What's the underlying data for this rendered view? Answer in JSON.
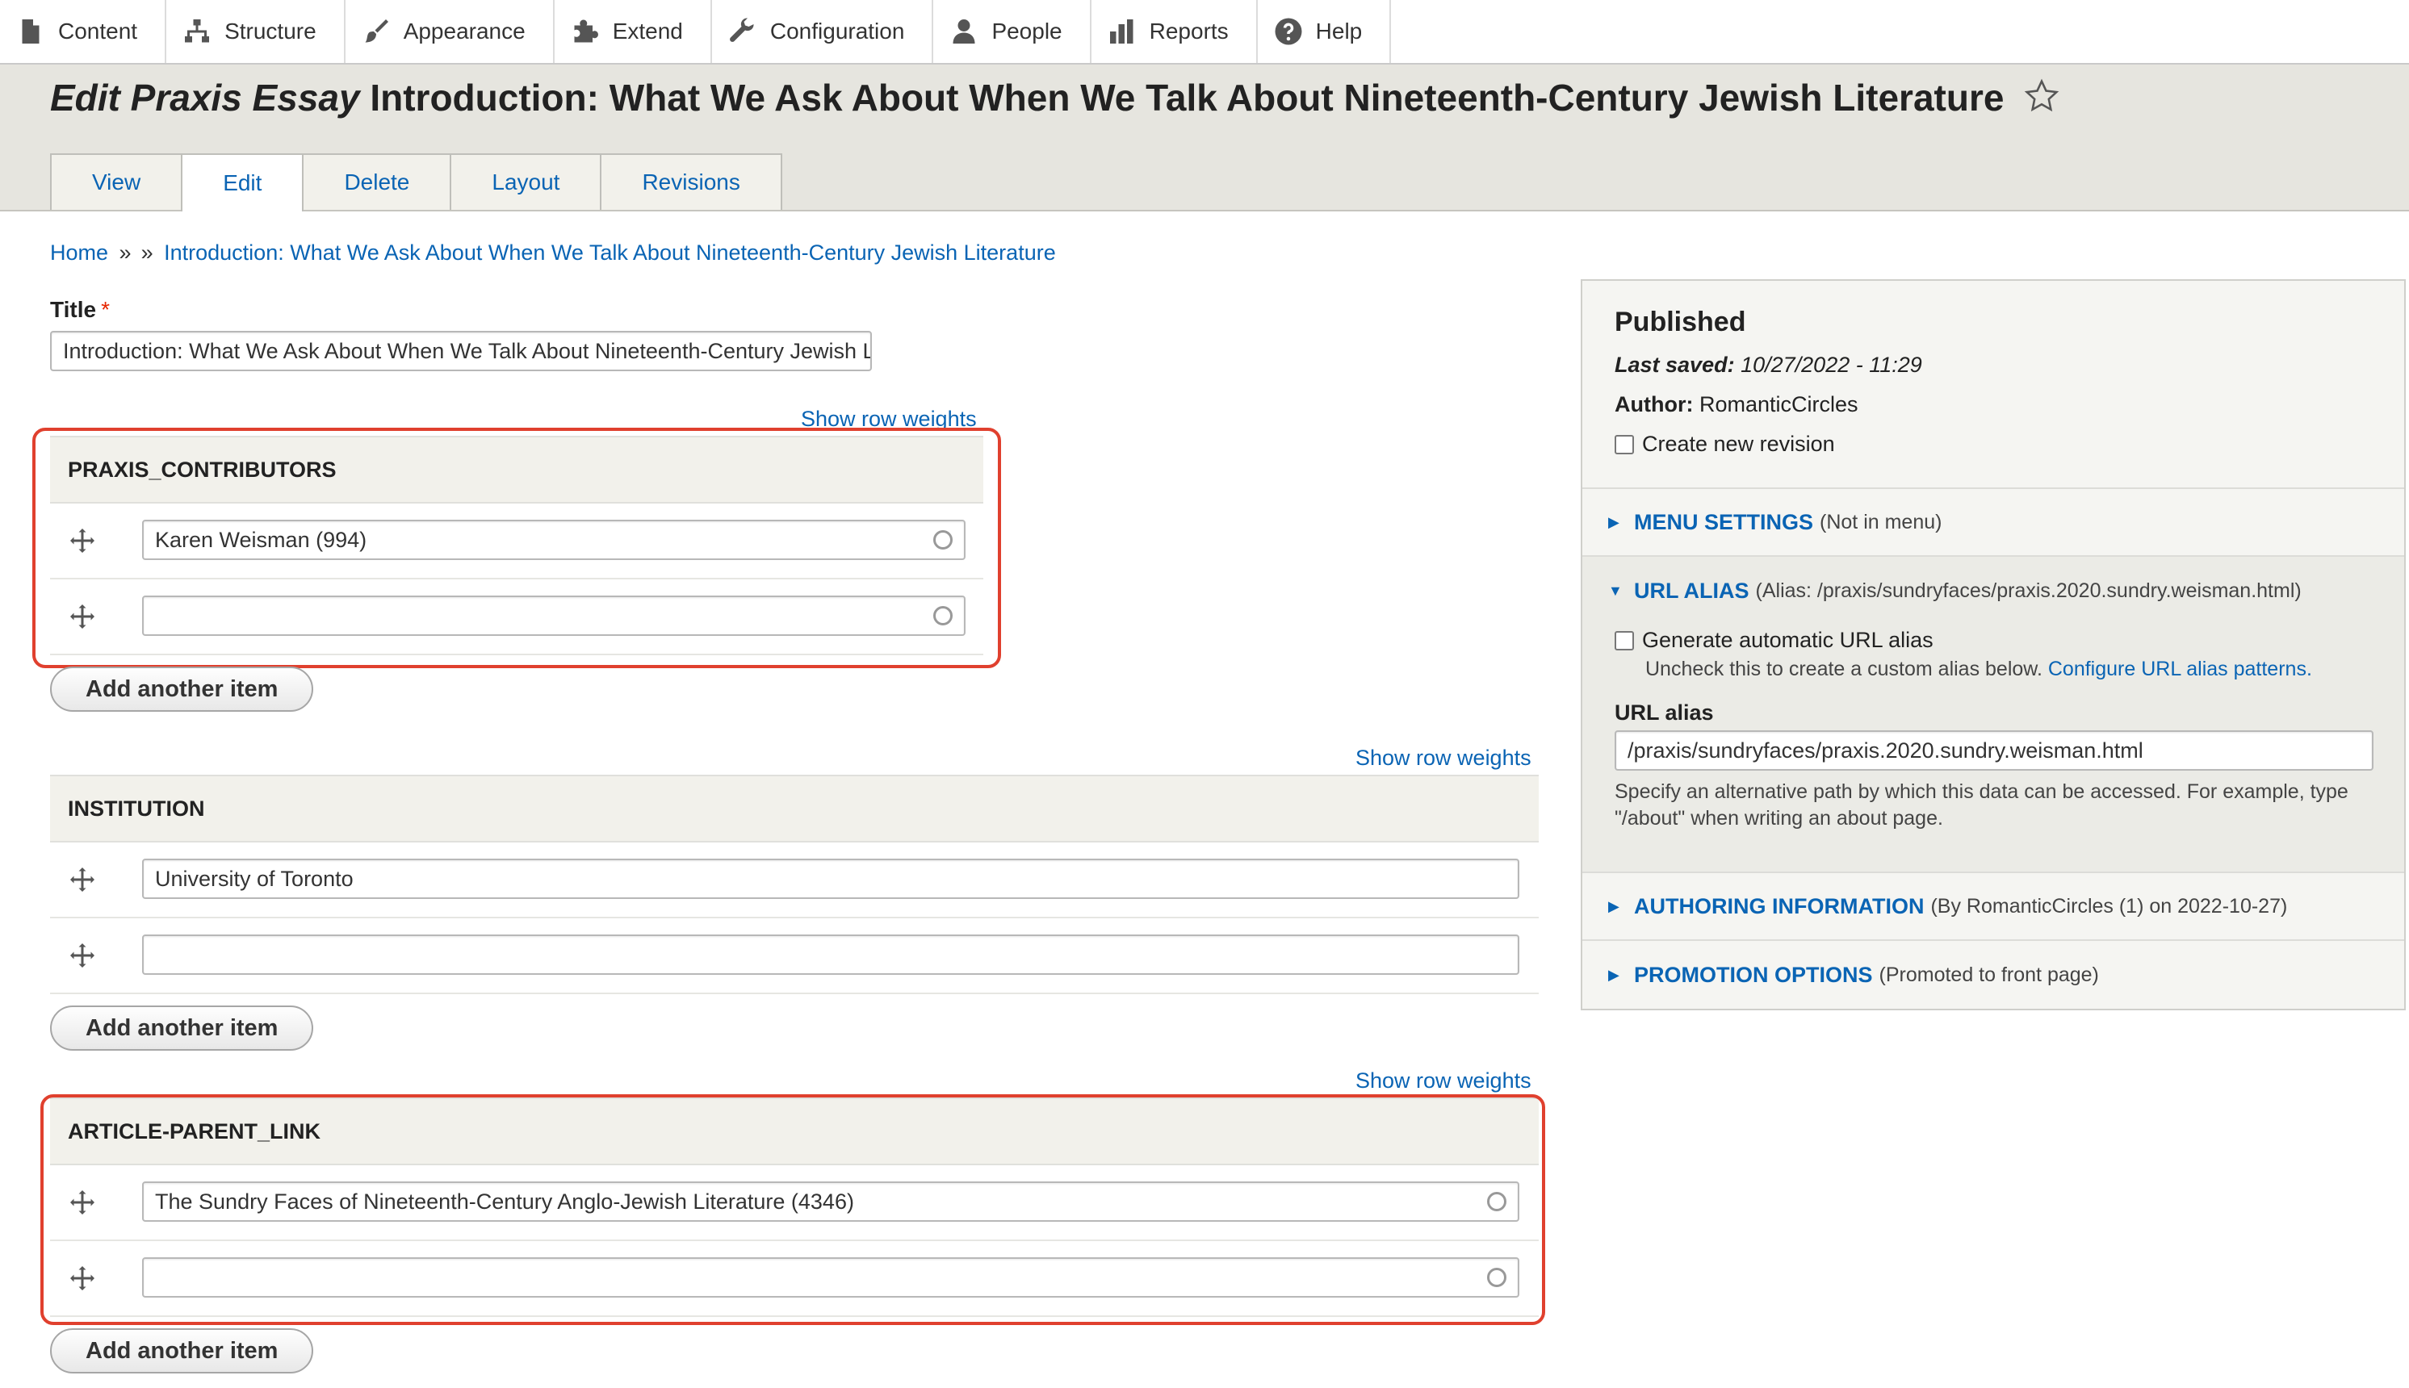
{
  "toolbar": {
    "items": [
      {
        "label": "Content",
        "icon": "page-icon"
      },
      {
        "label": "Structure",
        "icon": "sitemap-icon"
      },
      {
        "label": "Appearance",
        "icon": "paintbrush-icon"
      },
      {
        "label": "Extend",
        "icon": "puzzle-icon"
      },
      {
        "label": "Configuration",
        "icon": "wrench-icon"
      },
      {
        "label": "People",
        "icon": "person-icon"
      },
      {
        "label": "Reports",
        "icon": "bar-chart-icon"
      },
      {
        "label": "Help",
        "icon": "question-icon"
      }
    ]
  },
  "header": {
    "title_prefix": "Edit Praxis Essay",
    "title": "Introduction: What We Ask About When We Talk About Nineteenth-Century Jewish Literature",
    "tabs": [
      "View",
      "Edit",
      "Delete",
      "Layout",
      "Revisions"
    ],
    "active_tab": "Edit"
  },
  "breadcrumb": {
    "home": "Home",
    "sep": "»",
    "current": "Introduction: What We Ask About When We Talk About Nineteenth-Century Jewish Literature"
  },
  "form": {
    "title_label": "Title",
    "required_mark": "*",
    "title_value": "Introduction: What We Ask About When We Talk About Nineteenth-Century Jewish Literature",
    "show_row_weights": "Show row weights",
    "add_another": "Add another item",
    "contributors": {
      "heading": "PRAXIS_CONTRIBUTORS",
      "values": [
        "Karen Weisman (994)",
        ""
      ]
    },
    "institution": {
      "heading": "INSTITUTION",
      "values": [
        "University of Toronto",
        ""
      ]
    },
    "parent_link": {
      "heading": "ARTICLE-PARENT_LINK",
      "values": [
        "The Sundry Faces of Nineteenth-Century Anglo-Jewish Literature (4346)",
        ""
      ]
    }
  },
  "sidebar": {
    "status": "Published",
    "last_saved_label": "Last saved:",
    "last_saved_value": "10/27/2022 - 11:29",
    "author_label": "Author:",
    "author_value": "RomanticCircles",
    "new_revision_label": "Create new revision",
    "menu": {
      "title": "MENU SETTINGS",
      "summary": "(Not in menu)"
    },
    "url_alias": {
      "title": "URL ALIAS",
      "summary": "(Alias: /praxis/sundryfaces/praxis.2020.sundry.weisman.html)",
      "generate_label": "Generate automatic URL alias",
      "generate_desc": "Uncheck this to create a custom alias below.",
      "configure_link": "Configure URL alias patterns.",
      "alias_label": "URL alias",
      "alias_value": "/praxis/sundryfaces/praxis.2020.sundry.weisman.html",
      "alias_desc": "Specify an alternative path by which this data can be accessed. For example, type \"/about\" when writing an about page."
    },
    "authoring": {
      "title": "AUTHORING INFORMATION",
      "summary": "(By RomanticCircles (1) on 2022-10-27)"
    },
    "promotion": {
      "title": "PROMOTION OPTIONS",
      "summary": "(Promoted to front page)"
    }
  },
  "colors": {
    "link": "#0a64b4",
    "highlight": "#e0402e",
    "header_bg": "#e6e5df",
    "required": "#e62600"
  }
}
